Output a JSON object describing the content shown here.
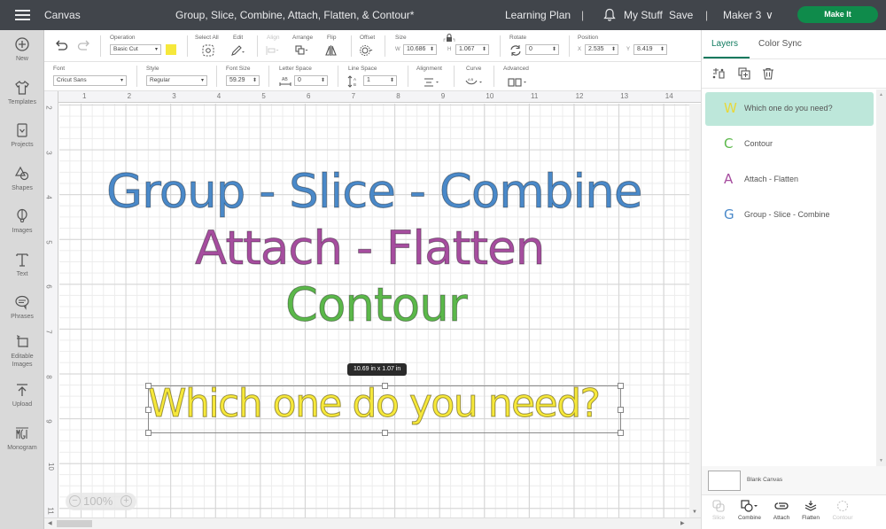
{
  "topbar": {
    "app_title": "Canvas",
    "doc_title": "Group, Slice, Combine, Attach, Flatten, & Contour*",
    "learning_plan": "Learning Plan",
    "separator": "|",
    "my_stuff": "My Stuff",
    "save": "Save",
    "machine": "Maker 3",
    "machine_caret": "∨",
    "make_it": "Make It"
  },
  "sidebar": {
    "items": [
      {
        "label": "New"
      },
      {
        "label": "Templates"
      },
      {
        "label": "Projects"
      },
      {
        "label": "Shapes"
      },
      {
        "label": "Images"
      },
      {
        "label": "Text"
      },
      {
        "label": "Phrases"
      },
      {
        "label": "Editable Images"
      },
      {
        "label": "Upload"
      },
      {
        "label": "Monogram"
      }
    ]
  },
  "toolbar": {
    "operation_label": "Operation",
    "operation_value": "Basic Cut",
    "operation_color": "#f6e83b",
    "select_all_label": "Select All",
    "edit_label": "Edit",
    "align_label": "Align",
    "arrange_label": "Arrange",
    "flip_label": "Flip",
    "offset_label": "Offset",
    "size_label": "Size",
    "width_prefix": "W",
    "width_value": "10.686",
    "height_prefix": "H",
    "height_value": "1.067",
    "rotate_label": "Rotate",
    "rotate_value": "0",
    "position_label": "Position",
    "x_prefix": "X",
    "x_value": "2.535",
    "y_prefix": "Y",
    "y_value": "8.419",
    "font_label": "Font",
    "font_value": "Cricut Sans",
    "style_label": "Style",
    "style_value": "Regular",
    "font_size_label": "Font Size",
    "font_size_value": "59.29",
    "letter_space_label": "Letter Space",
    "letter_space_value": "0",
    "line_space_label": "Line Space",
    "line_space_value": "1",
    "alignment_label": "Alignment",
    "curve_label": "Curve",
    "advanced_label": "Advanced",
    "dropdown_arrow": "▾",
    "spinner": "⬍"
  },
  "canvas": {
    "ruler_top": [
      "1",
      "2",
      "3",
      "4",
      "5",
      "6",
      "7",
      "8",
      "9",
      "10",
      "11",
      "12",
      "13",
      "14"
    ],
    "ruler_left": [
      "2",
      "3",
      "4",
      "5",
      "6",
      "7",
      "8",
      "9",
      "10",
      "11"
    ],
    "texts": [
      {
        "text": "Group - Slice - Combine",
        "color": "#4a89c9"
      },
      {
        "text": "Attach - Flatten",
        "color": "#a64d9f"
      },
      {
        "text": "Contour",
        "color": "#5bb84a"
      },
      {
        "text": "Which one do you need?",
        "color": "#f6e83b"
      }
    ],
    "size_tooltip": "10.69  in x 1.07  in",
    "zoom_level": "100%",
    "zoom_minus": "−",
    "zoom_plus": "+"
  },
  "right_panel": {
    "tabs": [
      {
        "label": "Layers",
        "active": true
      },
      {
        "label": "Color Sync",
        "active": false
      }
    ],
    "layers": [
      {
        "glyph": "W",
        "name": "Which one do you need?",
        "color": "#e8d83a",
        "selected": true
      },
      {
        "glyph": "C",
        "name": "Contour",
        "color": "#5bb84a",
        "selected": false
      },
      {
        "glyph": "A",
        "name": "Attach - Flatten",
        "color": "#a64d9f",
        "selected": false
      },
      {
        "glyph": "G",
        "name": "Group - Slice - Combine",
        "color": "#4a89c9",
        "selected": false
      }
    ],
    "blank_canvas_label": "Blank Canvas",
    "actions": [
      {
        "label": "Slice",
        "enabled": false
      },
      {
        "label": "Combine",
        "enabled": true
      },
      {
        "label": "Attach",
        "enabled": true
      },
      {
        "label": "Flatten",
        "enabled": true
      },
      {
        "label": "Contour",
        "enabled": false
      }
    ]
  }
}
